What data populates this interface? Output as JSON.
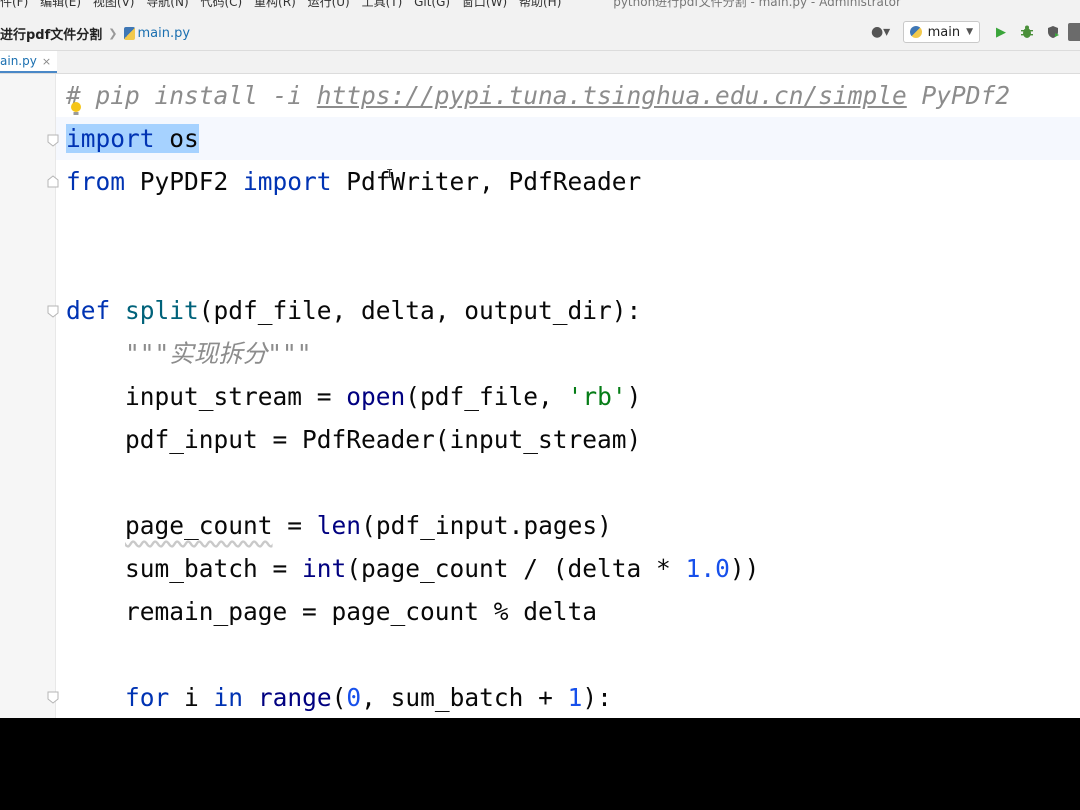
{
  "menubar": {
    "items": [
      "件(F)",
      "编辑(E)",
      "视图(V)",
      "导航(N)",
      "代码(C)",
      "重构(R)",
      "运行(U)",
      "工具(T)",
      "Git(G)",
      "窗口(W)",
      "帮助(H)"
    ],
    "window_title": "python进行pdf文件分割 - main.py - Administrator"
  },
  "navbar": {
    "project": "进行pdf文件分割",
    "file": "main.py"
  },
  "toolbar": {
    "run_config": "main"
  },
  "tab": {
    "label": "ain.py",
    "close": "×"
  },
  "code": {
    "l1_hash": "#",
    "l1_pre": " pip install -i ",
    "l1_url": "https://pypi.tuna.tsinghua.edu.cn/simple",
    "l1_post": " PyPDf2",
    "l2": "import os",
    "l3_kw1": "from",
    "l3_mid": " PyPDF2 ",
    "l3_kw2": "import",
    "l3_rest": " PdfWriter, PdfReader",
    "l6_kw": "def",
    "l6_fn": "split",
    "l6_rest": "(pdf_file, delta, output_dir):",
    "l7_doc": "\"\"\"实现拆分\"\"\"",
    "l8_a": "input_stream = ",
    "l8_bi": "open",
    "l8_b": "(pdf_file, ",
    "l8_str": "'rb'",
    "l8_c": ")",
    "l9": "pdf_input = PdfReader(input_stream)",
    "l11_var": "page_count",
    "l11_a": " = ",
    "l11_bi": "len",
    "l11_b": "(pdf_input.pages)",
    "l12_a": "sum_batch = ",
    "l12_bi": "int",
    "l12_b": "(page_count / (delta * ",
    "l12_num": "1.0",
    "l12_c": "))",
    "l13": "remain_page = page_count % delta",
    "l15_kw1": "for",
    "l15_a": " i ",
    "l15_kw2": "in",
    "l15_sp": " ",
    "l15_bi": "range",
    "l15_b": "(",
    "l15_n1": "0",
    "l15_c": ", sum_batch + ",
    "l15_n2": "1",
    "l15_d": "):"
  }
}
